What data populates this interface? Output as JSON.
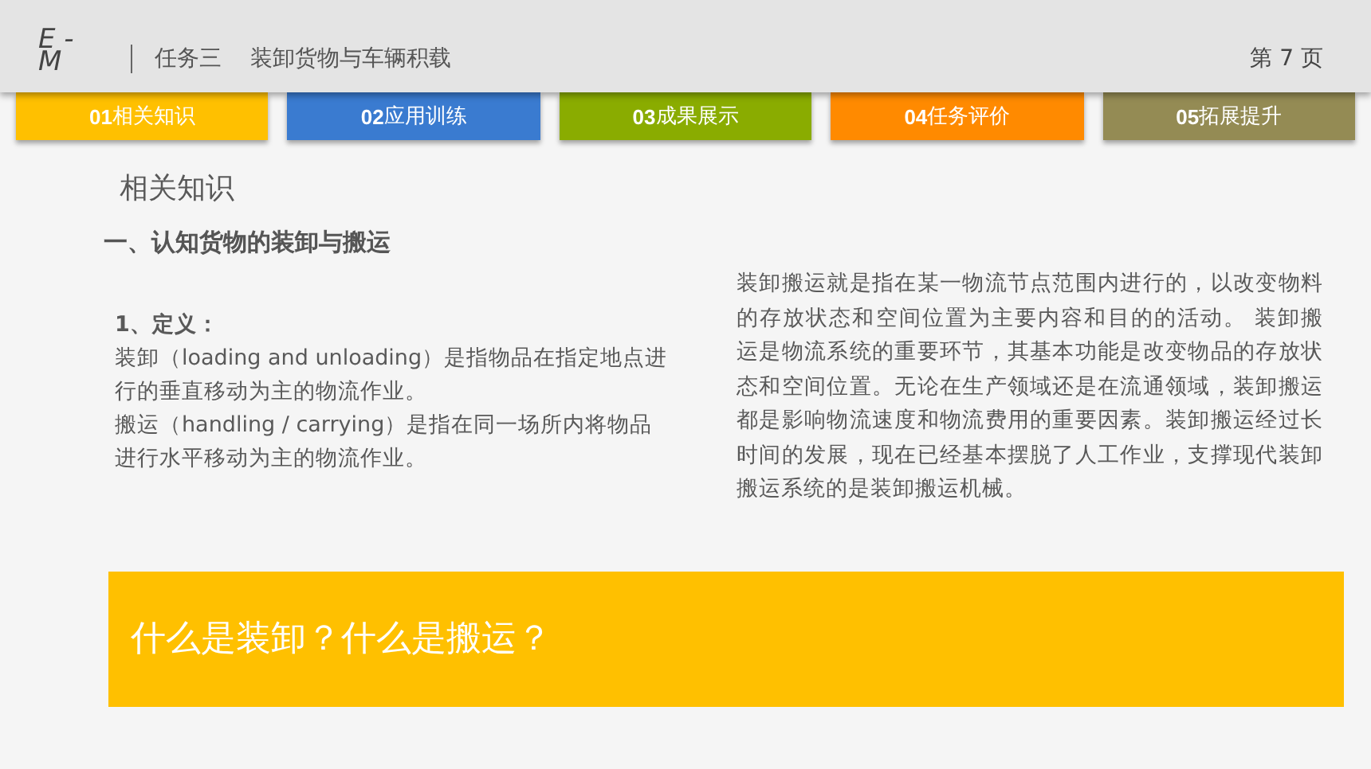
{
  "header": {
    "logo": [
      "E -",
      "M"
    ],
    "task": "任务三",
    "title": "装卸货物与车辆积载",
    "page": "第 7 页"
  },
  "tabs": [
    {
      "label": "**01**相关知识",
      "color": "#ffc000"
    },
    {
      "label": "**02**应用训练",
      "color": "#3a7bd0"
    },
    {
      "label": "**03**成果展示",
      "color": "#8aac00"
    },
    {
      "label": "**04**任务评价",
      "color": "#ff8a00"
    },
    {
      "label": "**05**拓展提升",
      "color": "#948b54"
    }
  ],
  "section_title": "相关知识",
  "heading": "一、认知货物的装卸与搬运",
  "definition": {
    "title": "1、定义：",
    "lines": [
      "装卸（loading and unloading）是指物品在指定地点进行的垂直移动为主的物流作业。",
      "搬运（handling / carrying）是指在同一场所内将物品进行水平移动为主的物流作业。"
    ]
  },
  "description": "装卸搬运就是指在某一物流节点范围内进行的，以改变物料的存放状态和空间位置为主要内容和目的的活动。 装卸搬运是物流系统的重要环节，其基本功能是改变物品的存放状态和空间位置。无论在生产领域还是在流通领域，装卸搬运都是影响物流速度和物流费用的重要因素。装卸搬运经过长时间的发展，现在已经基本摆脱了人工作业，支撑现代装卸搬运系统的是装卸搬运机械。",
  "banner": "什么是装卸？什么是搬运？"
}
